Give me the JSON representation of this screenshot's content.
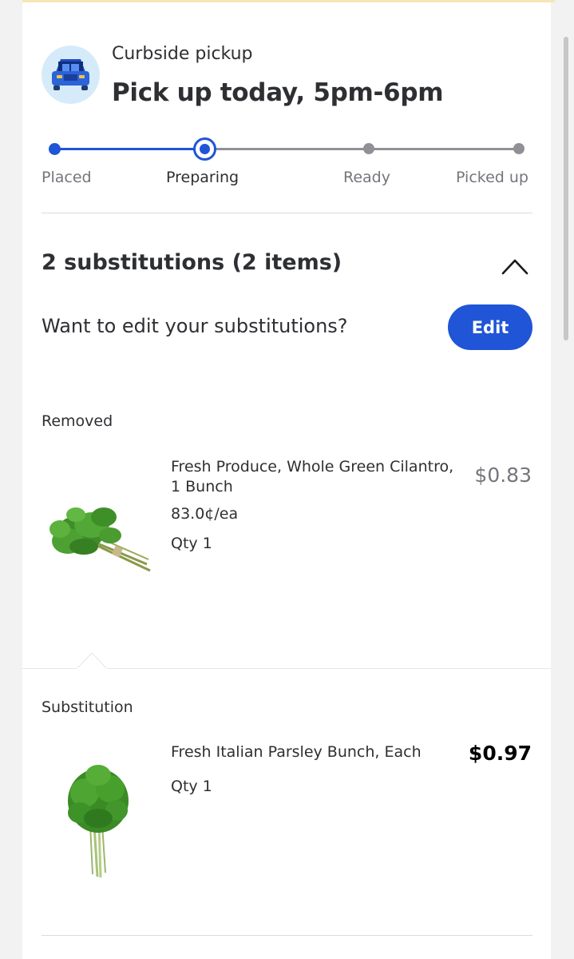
{
  "header": {
    "mode_label": "Curbside pickup",
    "pickup_title": "Pick up today, 5pm-6pm",
    "icon": "car-trunk-icon"
  },
  "progress": {
    "steps": [
      {
        "label": "Placed",
        "state": "done"
      },
      {
        "label": "Preparing",
        "state": "current"
      },
      {
        "label": "Ready",
        "state": "pending"
      },
      {
        "label": "Picked up",
        "state": "pending"
      }
    ]
  },
  "substitutions": {
    "heading": "2 substitutions (2 items)",
    "edit_question": "Want to edit your substitutions?",
    "edit_label": "Edit",
    "removed": {
      "section_label": "Removed",
      "name": "Fresh Produce, Whole Green Cilantro, 1 Bunch",
      "unit_price": "83.0¢/ea",
      "qty": "Qty 1",
      "price": "$0.83"
    },
    "substitution": {
      "section_label": "Substitution",
      "name": "Fresh Italian Parsley Bunch, Each",
      "qty": "Qty 1",
      "price": "$0.97"
    }
  },
  "colors": {
    "accent": "#1f55d6",
    "muted": "#909196",
    "text": "#2e2f32"
  }
}
